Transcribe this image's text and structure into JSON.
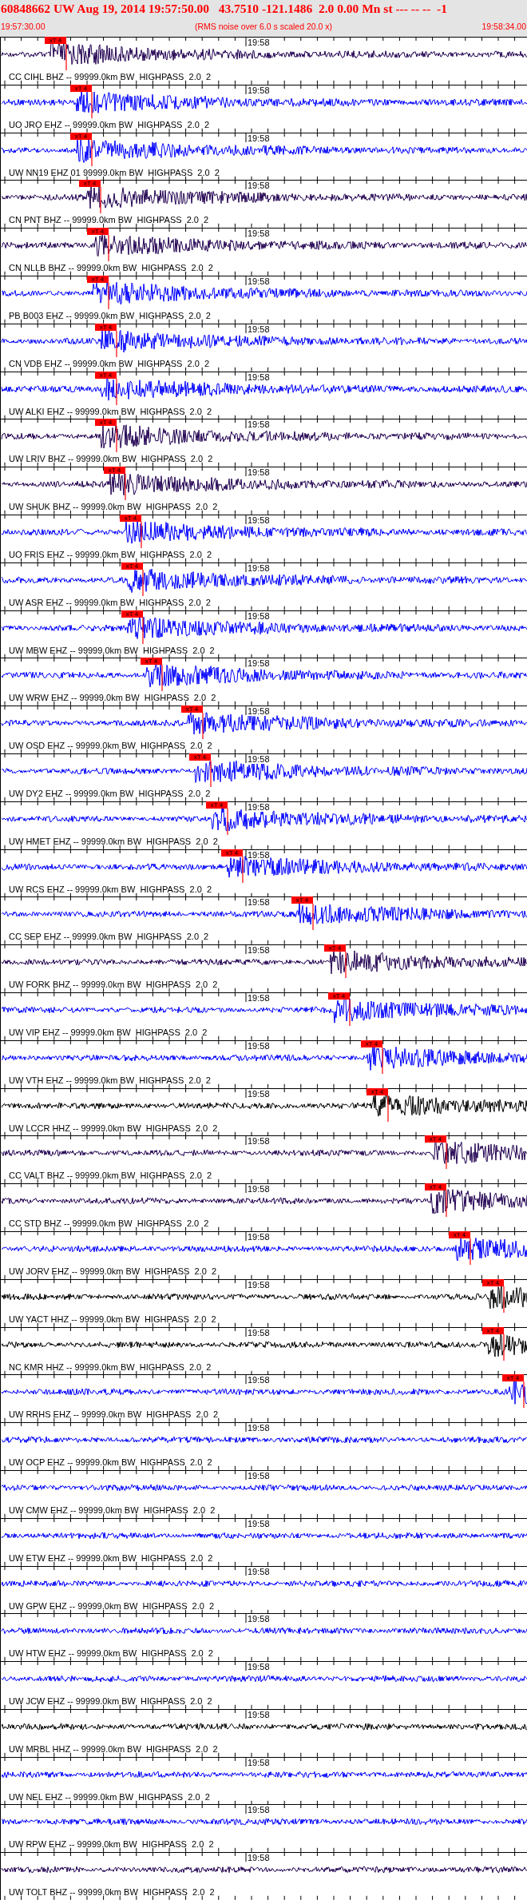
{
  "header": {
    "title": "60848662 UW Aug 19, 2014 19:57:50.00   43.7510 -121.1486  2.0 0.00 Mn st --- -- --  -1",
    "start_time": "19:57:30.00",
    "note": "(RMS noise over 6.0 s scaled 20.0 x)",
    "end_time": "19:58:34.00"
  },
  "traces": [
    {
      "label": "CC CIHL BHZ -- 99999.0km BW  HIGHPASS  2.0  2",
      "time": "19:58",
      "color": "#200050",
      "marker": "xT 4"
    },
    {
      "label": "UO JRO EHZ -- 99999.0km BW  HIGHPASS  2.0  2",
      "time": "19:58",
      "color": "#0000ff",
      "marker": "xT 4"
    },
    {
      "label": "UW NN19 EHZ 01 99999.0km BW  HIGHPASS  2.0  2",
      "time": "19:58",
      "color": "#0000ff",
      "marker": "xT 4"
    },
    {
      "label": "CN PNT BHZ -- 99999.0km BW  HIGHPASS  2.0  2",
      "time": "19:58",
      "color": "#200050",
      "marker": "xT 4"
    },
    {
      "label": "CN NLLB BHZ -- 99999.0km BW  HIGHPASS  2.0  2",
      "time": "19:58",
      "color": "#200050",
      "marker": "xT 4"
    },
    {
      "label": "PB B003 EHZ -- 99999.0km BW  HIGHPASS  2.0  2",
      "time": "19:58",
      "color": "#0000ff",
      "marker": "xT 4"
    },
    {
      "label": "CN VDB EHZ -- 99999.0km BW  HIGHPASS  2.0  2",
      "time": "19:58",
      "color": "#0000ff",
      "marker": "xT 4"
    },
    {
      "label": "UW ALKI EHZ -- 99999.0km BW  HIGHPASS  2.0  2",
      "time": "19:58",
      "color": "#0000ff",
      "marker": "xT 4"
    },
    {
      "label": "UW LRIV BHZ -- 99999.0km BW  HIGHPASS  2.0  2",
      "time": "19:58",
      "color": "#200050",
      "marker": "xT 4"
    },
    {
      "label": "UW SHUK BHZ -- 99999.0km BW  HIGHPASS  2.0  2",
      "time": "19:58",
      "color": "#200050",
      "marker": "xT 4"
    },
    {
      "label": "UO FRIS EHZ -- 99999.0km BW  HIGHPASS  2.0  2",
      "time": "19:58",
      "color": "#0000ff",
      "marker": "xT 4"
    },
    {
      "label": "UW ASR EHZ -- 99999.0km BW  HIGHPASS  2.0  2",
      "time": "19:58",
      "color": "#0000ff",
      "marker": "xT 4"
    },
    {
      "label": "UW MBW EHZ -- 99999.0km BW  HIGHPASS  2.0  2",
      "time": "19:58",
      "color": "#0000ff",
      "marker": "xT 4"
    },
    {
      "label": "UW WRW EHZ -- 99999.0km BW  HIGHPASS  2.0  2",
      "time": "19:58",
      "color": "#0000ff",
      "marker": "xT 4"
    },
    {
      "label": "UW OSD EHZ -- 99999.0km BW  HIGHPASS  2.0  2",
      "time": "19:58",
      "color": "#0000ff",
      "marker": "xT 4"
    },
    {
      "label": "UW DY2 EHZ -- 99999.0km BW  HIGHPASS  2.0  2",
      "time": "19:58",
      "color": "#0000ff",
      "marker": "xT 4"
    },
    {
      "label": "UW HMET EHZ -- 99999.0km BW  HIGHPASS  2.0  2",
      "time": "19:58",
      "color": "#0000ff",
      "marker": "xT 4"
    },
    {
      "label": "UW RCS EHZ -- 99999.0km BW  HIGHPASS  2.0  2",
      "time": "19:58",
      "color": "#0000ff",
      "marker": "xT 4"
    },
    {
      "label": "CC SEP EHZ -- 99999.0km BW  HIGHPASS  2.0  2",
      "time": "19:58",
      "color": "#0000ff",
      "marker": "xT 4"
    },
    {
      "label": "UW FORK BHZ -- 99999.0km BW  HIGHPASS  2.0  2",
      "time": "19:58",
      "color": "#200050",
      "marker": "xT 4"
    },
    {
      "label": "UW VIP EHZ -- 99999.0km BW  HIGHPASS  2.0  2",
      "time": "19:58",
      "color": "#0000ff",
      "marker": "xT 4"
    },
    {
      "label": "UW VTH EHZ -- 99999.0km BW  HIGHPASS  2.0  2",
      "time": "19:58",
      "color": "#0000ff",
      "marker": "xT 4"
    },
    {
      "label": "UW LCCR HHZ -- 99999.0km BW  HIGHPASS  2.0  2",
      "time": "19:58",
      "color": "#000000",
      "marker": "xT 4"
    },
    {
      "label": "CC VALT BHZ -- 99999.0km BW  HIGHPASS  2.0  2",
      "time": "19:58",
      "color": "#200050",
      "marker": "xT 4"
    },
    {
      "label": "CC STD BHZ -- 99999.0km BW  HIGHPASS  2.0  2",
      "time": "19:58",
      "color": "#200050",
      "marker": "xT 4"
    },
    {
      "label": "UW JORV EHZ -- 99999.0km BW  HIGHPASS  2.0  2",
      "time": "19:58",
      "color": "#0000ff",
      "marker": "xT 4"
    },
    {
      "label": "UW YACT HHZ -- 99999.0km BW  HIGHPASS  2.0  2",
      "time": "19:58",
      "color": "#000000",
      "marker": "xT 4"
    },
    {
      "label": "NC KMR HHZ -- 99999.0km BW  HIGHPASS  2.0  2",
      "time": "19:58",
      "color": "#000000",
      "marker": "xT 4"
    },
    {
      "label": "UW RRHS EHZ -- 99999.0km BW  HIGHPASS  2.0  2",
      "time": "19:58",
      "color": "#0000ff",
      "marker": "xT 4"
    },
    {
      "label": "UW OCP EHZ -- 99999.0km BW  HIGHPASS  2.0  2",
      "time": "19:58",
      "color": "#0000ff"
    },
    {
      "label": "UW CMW EHZ -- 99999.0km BW  HIGHPASS  2.0  2",
      "time": "19:58",
      "color": "#0000ff"
    },
    {
      "label": "UW ETW EHZ -- 99999.0km BW  HIGHPASS  2.0  2",
      "time": "19:58",
      "color": "#0000ff"
    },
    {
      "label": "UW GPW EHZ -- 99999.0km BW  HIGHPASS  2.0  2",
      "time": "19:58",
      "color": "#0000ff"
    },
    {
      "label": "UW HTW EHZ -- 99999.0km BW  HIGHPASS  2.0  2",
      "time": "19:58",
      "color": "#0000ff"
    },
    {
      "label": "UW JCW EHZ -- 99999.0km BW  HIGHPASS  2.0  2",
      "time": "19:58",
      "color": "#0000ff"
    },
    {
      "label": "UW MRBL HHZ -- 99999.0km BW  HIGHPASS  2.0  2",
      "time": "19:58",
      "color": "#000000"
    },
    {
      "label": "UW NEL EHZ -- 99999.0km BW  HIGHPASS  2.0  2",
      "time": "19:58",
      "color": "#0000ff"
    },
    {
      "label": "UW RPW EHZ -- 99999.0km BW  HIGHPASS  2.0  2",
      "time": "19:58",
      "color": "#0000ff"
    },
    {
      "label": "UW TOLT BHZ -- 99999.0km BW  HIGHPASS  2.0  2",
      "time": "19:58",
      "color": "#200050"
    }
  ]
}
